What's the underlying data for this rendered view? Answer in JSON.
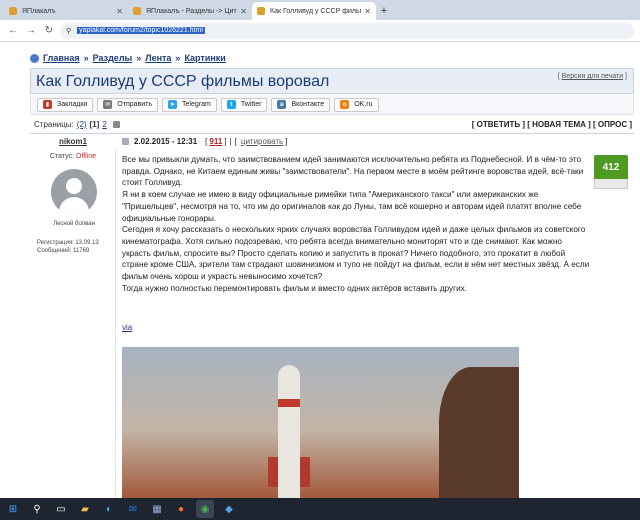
{
  "browser": {
    "tabs": [
      {
        "title": "ЯПлакалъ",
        "active": false
      },
      {
        "title": "ЯПлакалъ - Разделы -> Цитир…",
        "active": false
      },
      {
        "title": "Как Голливуд у СССР фильмы …",
        "active": true
      }
    ],
    "new_tab": "+",
    "url": "yaplakal.com/forum2/topic1026221.html"
  },
  "breadcrumb": {
    "items": [
      "Главная",
      "Разделы",
      "Лента",
      "Картинки"
    ],
    "separator": "»"
  },
  "topic": {
    "title": "Как Голливуд у СССР фильмы воровал",
    "print_version": "Версия для печати"
  },
  "share": {
    "buttons": [
      {
        "label": "Закладки",
        "icon": "bookmarks-icon",
        "color": "#c0392b"
      },
      {
        "label": "Отправить",
        "icon": "mail-icon",
        "color": "#777777"
      },
      {
        "label": "Telegram",
        "icon": "telegram-icon",
        "color": "#2ca5e0"
      },
      {
        "label": "Twitter",
        "icon": "twitter-icon",
        "color": "#1da1f2"
      },
      {
        "label": "Вконтакте",
        "icon": "vk-icon",
        "color": "#4a76a8"
      },
      {
        "label": "OK.ru",
        "icon": "ok-icon",
        "color": "#ee8208"
      }
    ]
  },
  "pagination": {
    "label": "Страницы:",
    "total": "(2)",
    "current": "[1]",
    "next": "2"
  },
  "topic_actions": "[ ОТВЕТИТЬ ] [ НОВАЯ ТЕМА ] [ ОПРОС ]",
  "post": {
    "author": "nikom1",
    "status_label": "Статус:",
    "status_value": "Offline",
    "rank": "Лесной болван",
    "registration": "Регистрация: 13.09.13",
    "messages": "Сообщений: 11769",
    "date": "2.02.2015 - 12:31",
    "number": "911",
    "bracket_open": "[",
    "bracket_close": "]",
    "separator": "|",
    "quote": "цитировать",
    "rating": "412",
    "body": [
      "Все мы привыкли думать, что заимствованием идей занимаются исключительно ребята из Поднебесной. И в чём-то это правда. Однако, не Китаем единым живы \"заимствователи\". На первом месте в моём рейтинге воровства идей, всё-таки стоит Голливуд.",
      "Я ни в коем случае не имею в виду официальные римейки типа \"Американского такси\" или американских же \"Пришельцев\", несмотря на то, что им до оригиналов как до Луны, там всё кошерно и авторам идей платят вполне себе официальные гонорары.",
      "Сегодня я хочу рассказать о нескольких ярких случаях воровства Голливудом идей и даже целых фильмов из советского кинематографа. Хотя сильно подозреваю, что ребята всегда внимательно мониторят что и где снимают. Как можно украсть фильм, спросите вы? Просто сделать копию и запустить в прокат? Ничего подобного, это прокатит в любой стране кроме США, зрители там страдают шовинизмом и тупо не пойдут на фильм, если в нём нет местных звёзд. А если фильм очень хорош и украсть невыносимо хочется?",
      "Тогда нужно полностью перемонтировать фильм и вместо одних актёров вставить других."
    ],
    "via": "via"
  },
  "taskbar": {
    "icons": [
      "windows-start-icon",
      "search-icon",
      "task-view-icon",
      "file-explorer-icon",
      "edge-icon",
      "outlook-icon",
      "store-icon",
      "firefox-icon",
      "chrome-icon",
      "app-icon"
    ]
  }
}
